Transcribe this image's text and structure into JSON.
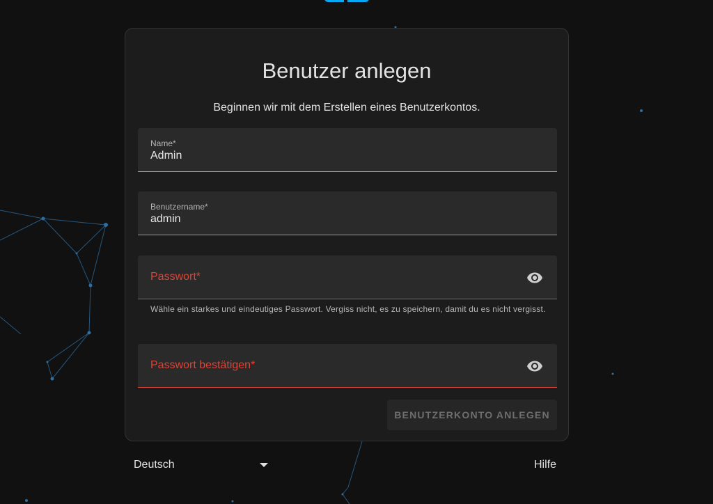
{
  "card": {
    "title": "Benutzer anlegen",
    "subtitle": "Beginnen wir mit dem Erstellen eines Benutzerkontos."
  },
  "form": {
    "name": {
      "label": "Name*",
      "value": "Admin"
    },
    "username": {
      "label": "Benutzername*",
      "value": "admin"
    },
    "password": {
      "label": "Passwort*",
      "value": "",
      "helper": "Wähle ein starkes und eindeutiges Passwort. Vergiss nicht, es zu speichern, damit du es nicht vergisst.",
      "icon": "eye-icon"
    },
    "password_confirm": {
      "label": "Passwort bestätigen*",
      "value": "",
      "icon": "eye-icon"
    },
    "submit_label": "BENUTZERKONTO ANLEGEN"
  },
  "footer": {
    "language": "Deutsch",
    "language_icon": "chevron-down-icon",
    "help": "Hilfe"
  },
  "colors": {
    "background": "#111111",
    "card": "#1c1c1c",
    "field": "#2a2a2a",
    "error": "#db4437",
    "accent": "#03a9f4",
    "network": "#2d6fa3"
  }
}
